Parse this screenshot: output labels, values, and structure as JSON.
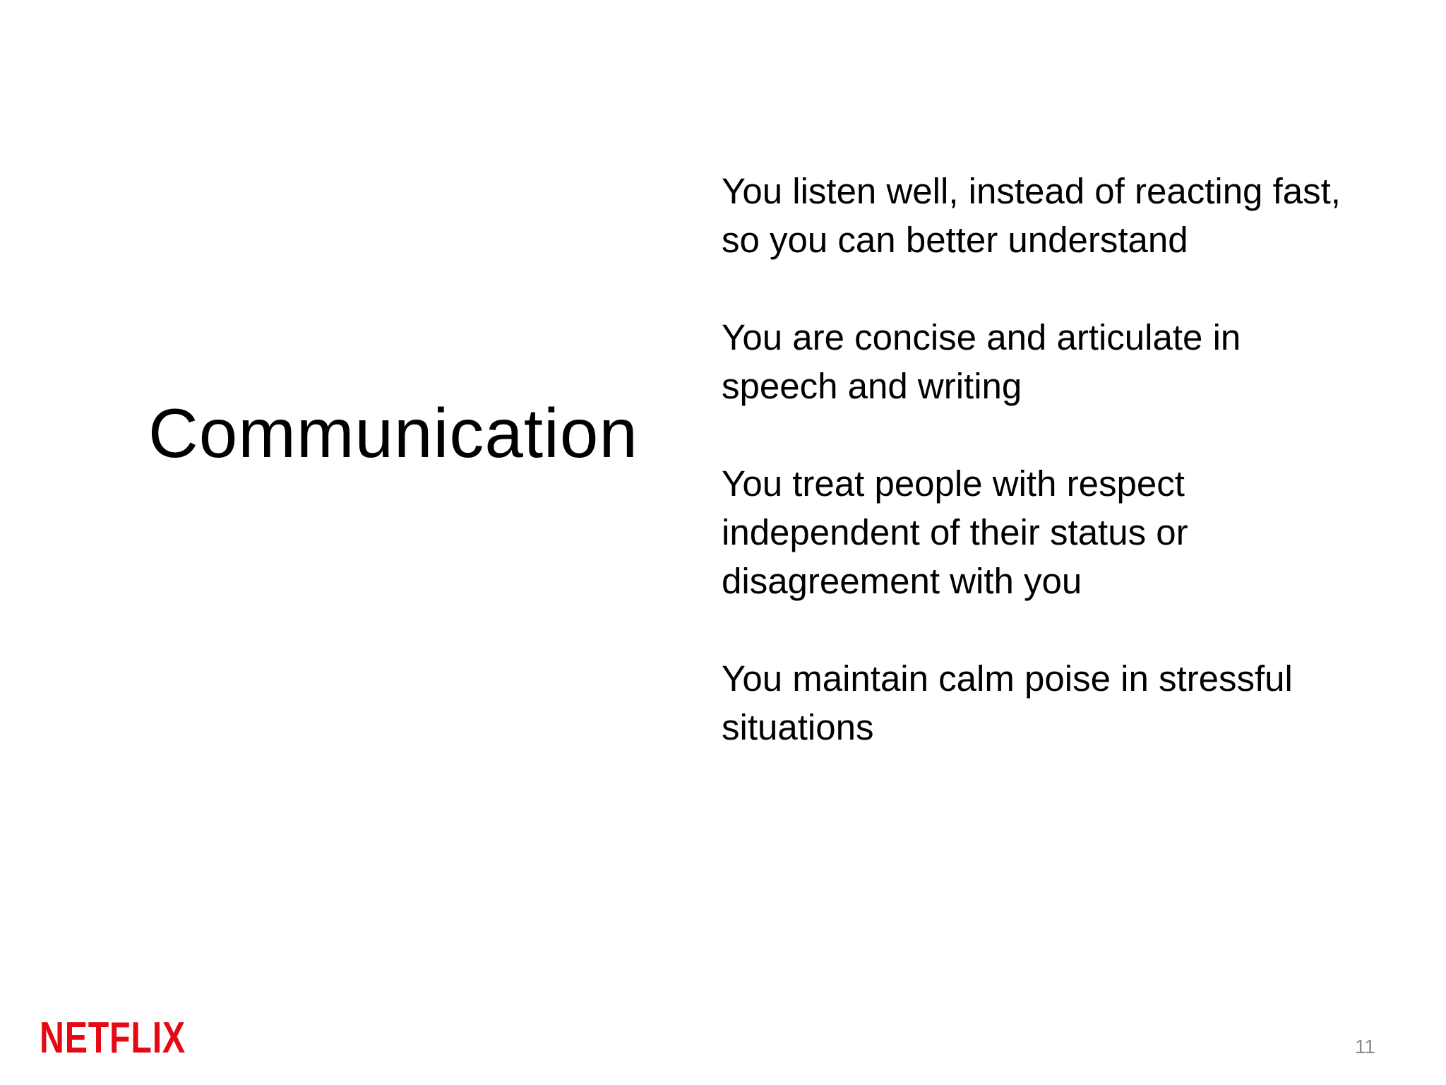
{
  "slide": {
    "title": "Communication",
    "points": [
      "You listen well, instead of reacting fast, so you can better understand",
      "You are concise and articulate in speech and writing",
      "You treat people with respect independent of their status or disagreement with you",
      "You maintain calm poise in stressful situations"
    ],
    "logo_text": "NETFLIX",
    "page_number": "11"
  },
  "colors": {
    "background": "#ffffff",
    "text": "#000000",
    "brand_red": "#E50914",
    "page_number": "#8c8c8c"
  }
}
